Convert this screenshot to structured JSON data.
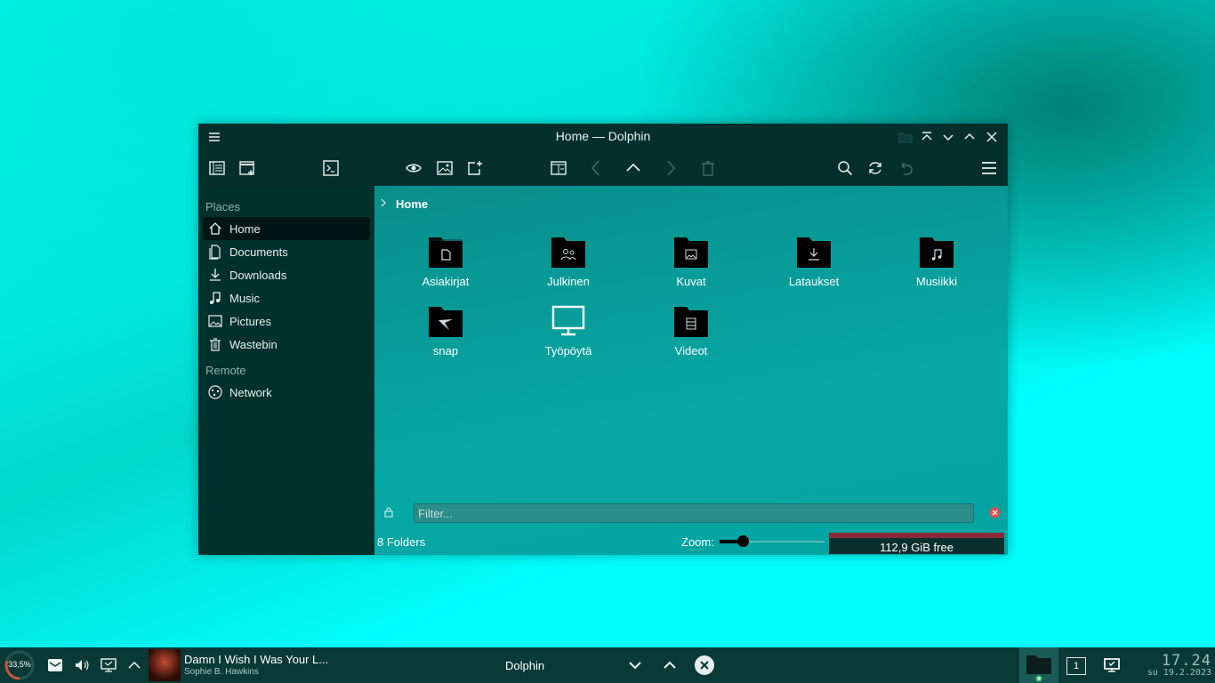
{
  "window": {
    "title": "Home — Dolphin"
  },
  "sidebar": {
    "places_header": "Places",
    "remote_header": "Remote",
    "places": [
      {
        "label": "Home",
        "icon": "home-icon",
        "active": true
      },
      {
        "label": "Documents",
        "icon": "documents-icon"
      },
      {
        "label": "Downloads",
        "icon": "download-icon"
      },
      {
        "label": "Music",
        "icon": "music-icon"
      },
      {
        "label": "Pictures",
        "icon": "pictures-icon"
      },
      {
        "label": "Wastebin",
        "icon": "trash-icon"
      }
    ],
    "remote": [
      {
        "label": "Network",
        "icon": "network-icon"
      }
    ]
  },
  "breadcrumb": {
    "current": "Home"
  },
  "files": [
    {
      "name": "Asiakirjat",
      "icon": "folder-documents-icon"
    },
    {
      "name": "Julkinen",
      "icon": "folder-public-icon"
    },
    {
      "name": "Kuvat",
      "icon": "folder-pictures-icon"
    },
    {
      "name": "Lataukset",
      "icon": "folder-downloads-icon"
    },
    {
      "name": "Musiikki",
      "icon": "folder-music-icon"
    },
    {
      "name": "snap",
      "icon": "folder-snap-icon"
    },
    {
      "name": "Työpöytä",
      "icon": "desktop-icon"
    },
    {
      "name": "Videot",
      "icon": "folder-videos-icon"
    }
  ],
  "filter": {
    "placeholder": "Filter..."
  },
  "status": {
    "count": "8 Folders",
    "zoom_label": "Zoom:",
    "zoom_level": 0.22,
    "free_space": "112,9 GiB free"
  },
  "taskbar": {
    "cpu_percent": "33,5%",
    "media": {
      "song": "Damn I Wish I Was Your L...",
      "artist": "Sophie B. Hawkins"
    },
    "task_title": "Dolphin",
    "desktop_number": "1",
    "clock": {
      "time": "17.24",
      "date": "su 19.2.2023"
    }
  },
  "colors": {
    "window_bg": "#042d2b",
    "view_bg": "#06a8a5",
    "desktop_bg": "#00ffff",
    "free_bar": "#8b2a36"
  }
}
